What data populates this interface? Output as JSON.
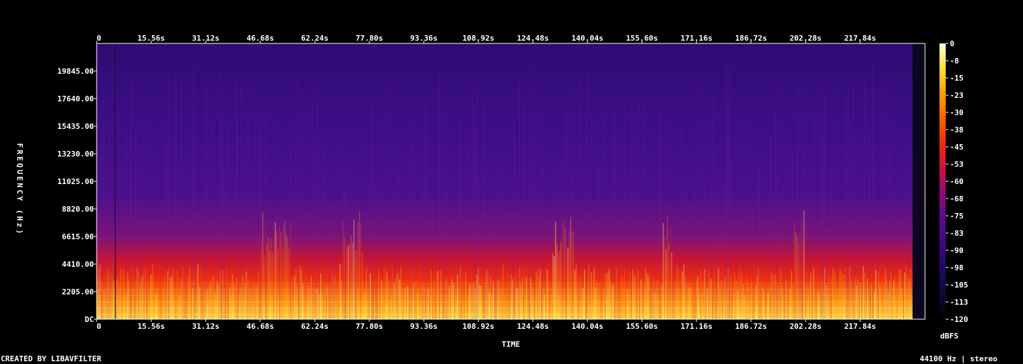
{
  "chart_data": {
    "type": "heatmap",
    "xlabel": "TIME",
    "ylabel": "FREQUENCY (Hz)",
    "x_ticks": [
      "0",
      "15.56s",
      "31.12s",
      "46.68s",
      "62.24s",
      "77.80s",
      "93.36s",
      "108.92s",
      "124.48s",
      "140.04s",
      "155.60s",
      "171.16s",
      "186.72s",
      "202.28s",
      "217.84s"
    ],
    "y_ticks": [
      "DC",
      "2205.00",
      "4410.00",
      "6615.00",
      "8820.00",
      "11025.00",
      "13230.00",
      "15435.00",
      "17640.00",
      "19845.00"
    ],
    "xlim": [
      0,
      230
    ],
    "ylim": [
      0,
      22050
    ],
    "colorbar": {
      "label": "dBFS",
      "ticks": [
        "0",
        "-8",
        "-15",
        "-23",
        "-30",
        "-38",
        "-45",
        "-53",
        "-60",
        "-68",
        "-75",
        "-83",
        "-90",
        "-98",
        "-105",
        "-113",
        "-120"
      ],
      "range": [
        -120,
        0
      ],
      "stops": [
        "#000000",
        "#0a0a3c",
        "#1e0a64",
        "#3c0a82",
        "#5a0a8c",
        "#8c0a78",
        "#c8143c",
        "#f0280a",
        "#ff6400",
        "#ffa000",
        "#ffdc3c",
        "#ffffd2"
      ]
    }
  },
  "footer": {
    "left": "CREATED BY LIBAVFILTER",
    "right": "44100 Hz | stereo"
  }
}
